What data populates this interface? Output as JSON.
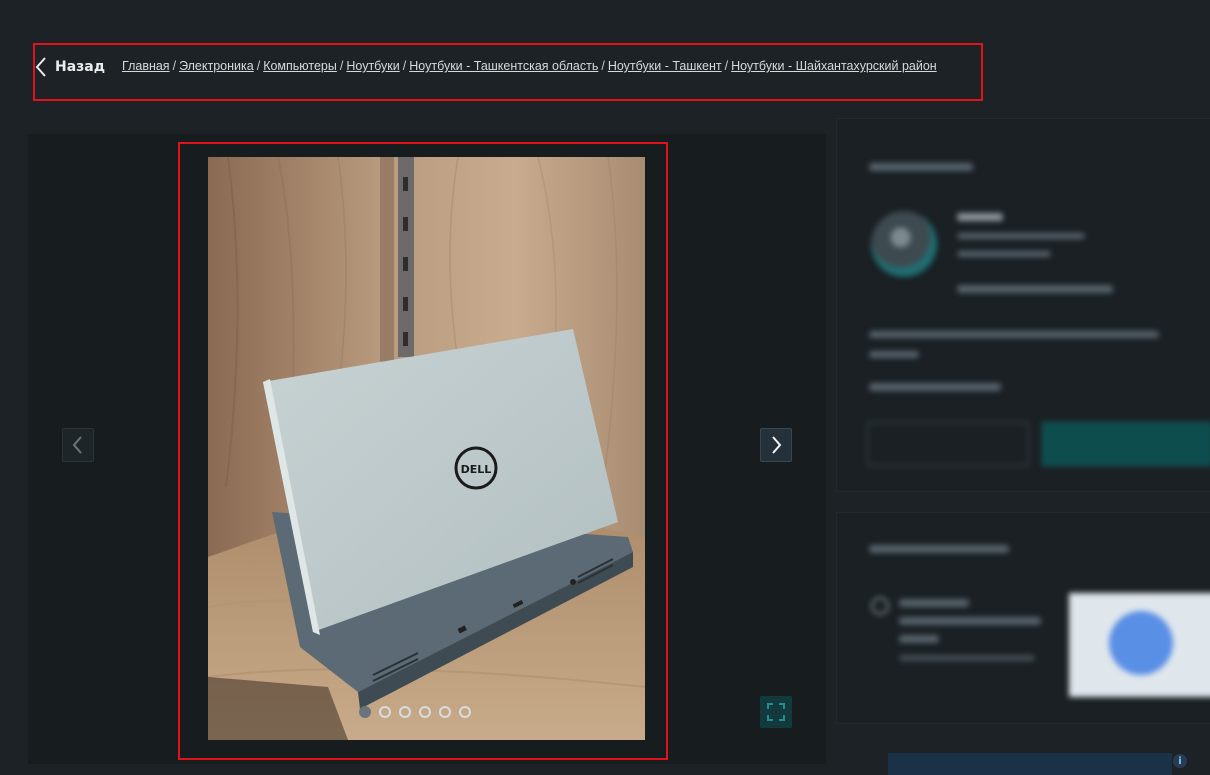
{
  "header": {
    "back_label": "Назад",
    "breadcrumbs": [
      "Главная",
      "Электроника",
      "Компьютеры",
      "Ноутбуки",
      "Ноутбуки - Ташкентская область",
      "Ноутбуки - Ташкент",
      "Ноутбуки - Шайхантахурский район"
    ],
    "separator": "/"
  },
  "gallery": {
    "photo_subject": "Dell laptop",
    "logo_text": "DELL",
    "slides_total": 6,
    "active_slide": 1
  },
  "colors": {
    "background": "#1c2226",
    "highlight_box": "#e0121a",
    "primary_button": "#0d4d4e"
  },
  "icons": {
    "back": "chevron-left-icon",
    "prev": "chevron-left-icon",
    "next": "chevron-right-icon",
    "fullscreen": "expand-icon",
    "info": "info-icon"
  },
  "info_badge": "i"
}
